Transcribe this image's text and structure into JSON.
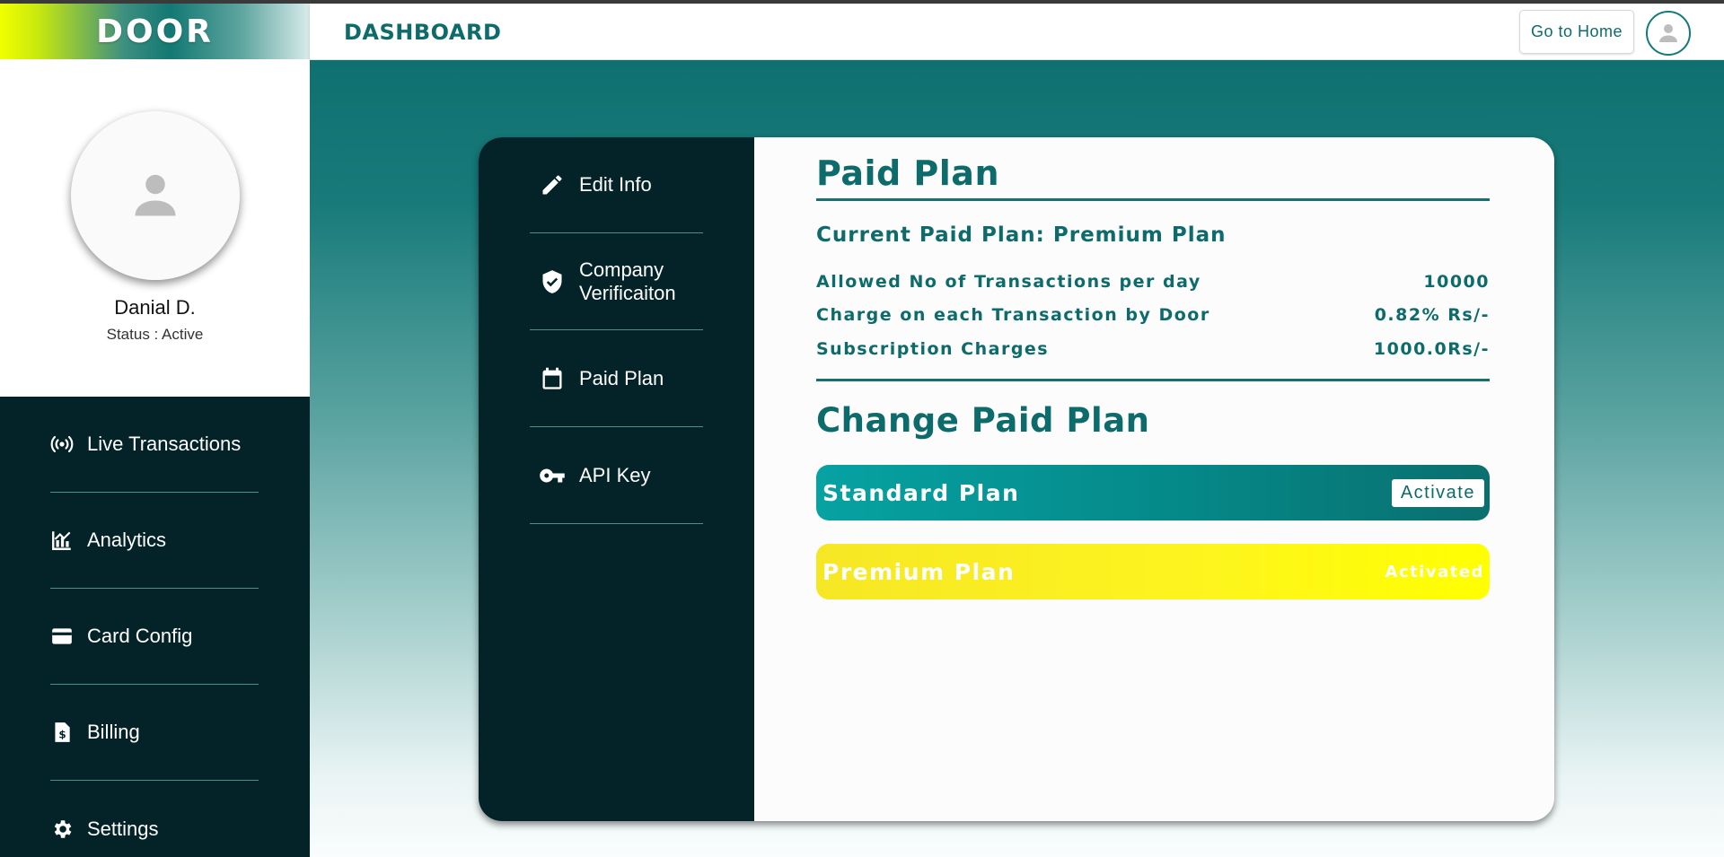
{
  "brand": {
    "name": "DOOR"
  },
  "profile": {
    "name": "Danial D.",
    "status": "Status : Active"
  },
  "sidebar": {
    "items": [
      {
        "label": "Live Transactions",
        "icon": "broadcast-icon"
      },
      {
        "label": "Analytics",
        "icon": "analytics-icon"
      },
      {
        "label": "Card Config",
        "icon": "card-icon"
      },
      {
        "label": "Billing",
        "icon": "billing-icon"
      },
      {
        "label": "Settings",
        "icon": "gear-icon"
      }
    ]
  },
  "topbar": {
    "title": "DASHBOARD",
    "go_home": "Go to Home",
    "user_icon": "user-icon"
  },
  "settings_nav": {
    "items": [
      {
        "label": "Edit Info",
        "icon": "pencil-icon"
      },
      {
        "label": "Company Verificaiton",
        "icon": "shield-check-icon"
      },
      {
        "label": "Paid Plan",
        "icon": "calendar-icon"
      },
      {
        "label": "API Key",
        "icon": "key-icon"
      }
    ]
  },
  "paid_plan": {
    "heading": "Paid Plan",
    "current": "Current Paid Plan: Premium Plan",
    "details": [
      {
        "label": "Allowed No of Transactions per day",
        "value": "10000"
      },
      {
        "label": "Charge on each Transaction by Door",
        "value": "0.82% Rs/-"
      },
      {
        "label": "Subscription Charges",
        "value": "1000.0Rs/-"
      }
    ],
    "change_heading": "Change Paid Plan",
    "plans": [
      {
        "name": "Standard Plan",
        "action": "Activate"
      },
      {
        "name": "Premium Plan",
        "action": "Activated"
      }
    ]
  },
  "colors": {
    "primary": "#0d6b6b",
    "dark_nav": "#032328",
    "premium_yellow": "#ffff00",
    "standard_teal": "#058888"
  }
}
